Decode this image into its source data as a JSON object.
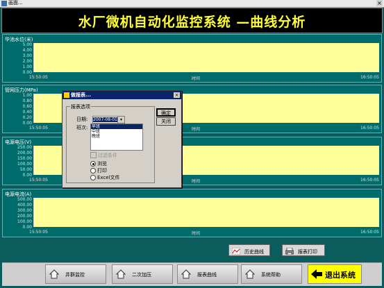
{
  "window": {
    "title": "画面..."
  },
  "header": {
    "title": "水厂微机自动化监控系统 —曲线分析"
  },
  "panels": [
    {
      "label": "华池水位(米)",
      "ticks": [
        "5.00",
        "4.00",
        "3.00",
        "2.00",
        "1.00",
        "0.00"
      ],
      "time_start": "15:50:05",
      "time_label": "时间",
      "time_end": "16:50:05"
    },
    {
      "label": "管网压力(MPa)",
      "ticks": [
        "1.00",
        "0.80",
        "0.60",
        "0.40",
        "0.20",
        "0.00"
      ],
      "time_start": "15:50:05",
      "time_label": "时间",
      "time_end": "16:50:05"
    },
    {
      "label": "电源电压(V)",
      "ticks": [
        "250.00",
        "200.00",
        "150.00",
        "100.00",
        "50.00",
        "0.00"
      ],
      "time_start": "15:50:05",
      "time_label": "时间",
      "time_end": "16:50:05"
    },
    {
      "label": "电源电流(A)",
      "ticks": [
        "500.00",
        "400.00",
        "300.00",
        "200.00",
        "100.00",
        "0.00"
      ],
      "time_start": "15:50:05",
      "time_label": "时间",
      "time_end": "16:50:05"
    }
  ],
  "actions": {
    "history_label": "历史曲线",
    "print_label": "报表打印"
  },
  "nav": {
    "items": [
      {
        "label": "井群监控"
      },
      {
        "label": "二次加压"
      },
      {
        "label": "报表曲线"
      },
      {
        "label": "系统帮助"
      }
    ],
    "exit_label": "退出系统"
  },
  "dialog": {
    "title": "做报表...",
    "group_label": "报表选项",
    "date_label": "日期:",
    "date_value": "2007-08-01",
    "shift_label": "班次:",
    "shifts": [
      "早班",
      "中班",
      "晚班"
    ],
    "selected_shift": "早班",
    "filter_label": "过滤条件",
    "output_options": [
      "浏览",
      "打印",
      "Excel文件"
    ],
    "selected_output": "浏览",
    "ok_label": "确定",
    "close_label": "关闭"
  }
}
